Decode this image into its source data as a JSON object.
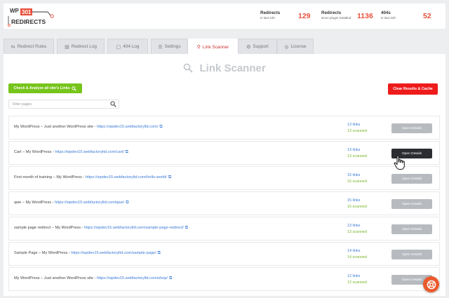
{
  "header": {
    "logo_top": "WP",
    "logo_mid": "301",
    "logo_bottom": "REDIRECTS",
    "stats": [
      {
        "label": "Redirects",
        "sub": "in last 24h",
        "value": "129"
      },
      {
        "label": "Redirects",
        "sub": "since plugin installed",
        "value": "1136"
      },
      {
        "label": "404s",
        "sub": "in last 24h",
        "value": "52"
      }
    ]
  },
  "tabs": [
    {
      "label": "Redirect Rules",
      "icon": "redirect-icon"
    },
    {
      "label": "Redirect Log",
      "icon": "log-icon"
    },
    {
      "label": "404 Log",
      "icon": "404-log-icon"
    },
    {
      "label": "Settings",
      "icon": "settings-icon"
    },
    {
      "label": "Link Scanner",
      "icon": "search-icon"
    },
    {
      "label": "Support",
      "icon": "support-icon"
    },
    {
      "label": "License",
      "icon": "license-icon"
    }
  ],
  "active_tab": "Link Scanner",
  "page": {
    "title": "Link Scanner",
    "check_button": "Check & Analyze all site's Links",
    "clear_button": "Clear Results & Cache",
    "filter_placeholder": "Filter pages"
  },
  "rows": [
    {
      "title": "My WordPress – Just another WordPress site",
      "url": "https://wpdev15.webfactoryltd.com/",
      "links": "13 links",
      "scanned": "13 scanned",
      "button": "Open Details"
    },
    {
      "title": "Cart – My WordPress",
      "url": "https://wpdev15.webfactoryltd.com/cart/",
      "links": "13 links",
      "scanned": "13 scanned",
      "button": "Open Details"
    },
    {
      "title": "First month of training – My WordPress",
      "url": "https://wpdev15.webfactoryltd.com/hello-world/",
      "links": "15 links",
      "scanned": "15 scanned",
      "button": "Open Details"
    },
    {
      "title": "qwe – My WordPress",
      "url": "https://wpdev15.webfactoryltd.com/qwe/",
      "links": "15 links",
      "scanned": "15 scanned",
      "button": "Open Details"
    },
    {
      "title": "sample page redirect – My WordPress",
      "url": "https://wpdev15.webfactoryltd.com/sample-page-redirect/",
      "links": "13 links",
      "scanned": "13 scanned",
      "button": "Open Details"
    },
    {
      "title": "Sample Page – My WordPress",
      "url": "https://wpdev15.webfactoryltd.com/sample-page/",
      "links": "14 links",
      "scanned": "14 scanned",
      "button": "Open Details"
    },
    {
      "title": "My WordPress – Just another WordPress site",
      "url": "https://wpdev15.webfactoryltd.com/shop/",
      "links": "12 links",
      "scanned": "12 scanned",
      "button": "Open Details"
    }
  ],
  "colors": {
    "accent": "#e8503a",
    "green": "#77c41b",
    "red": "#ee1b1b",
    "link": "#3a7ad6",
    "scanned": "#77b52a"
  }
}
